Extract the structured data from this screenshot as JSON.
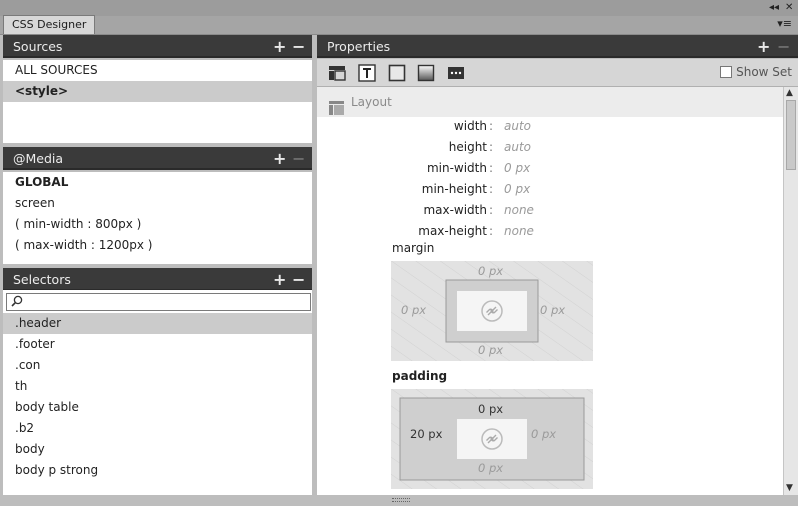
{
  "window": {
    "tab_label": "CSS Designer",
    "collapse_icon": "double-left-arrow-icon",
    "close_icon": "close-icon",
    "menu_icon": "panel-menu-icon"
  },
  "sources": {
    "title": "Sources",
    "items": [
      {
        "label": "ALL SOURCES",
        "selected": false
      },
      {
        "label": "<style>",
        "selected": true
      }
    ]
  },
  "media": {
    "title": "@Media",
    "items": [
      {
        "label": "GLOBAL"
      },
      {
        "label": "screen"
      },
      {
        "label": "( min-width : 800px )"
      },
      {
        "label": "( max-width : 1200px )"
      }
    ]
  },
  "selectors": {
    "title": "Selectors",
    "search_placeholder": "",
    "items": [
      {
        "label": ".header",
        "selected": true
      },
      {
        "label": ".footer"
      },
      {
        "label": ".con"
      },
      {
        "label": "th"
      },
      {
        "label": "body table"
      },
      {
        "label": ".b2"
      },
      {
        "label": "body"
      },
      {
        "label": "body p strong"
      }
    ]
  },
  "properties": {
    "title": "Properties",
    "show_set_label": "Show Set",
    "show_set_checked": false,
    "toolbar_icons": [
      "layout-icon",
      "text-icon",
      "border-icon",
      "background-icon",
      "more-icon"
    ],
    "section_title": "Layout",
    "layout_props": [
      {
        "name": "width",
        "value": "auto"
      },
      {
        "name": "height",
        "value": "auto"
      },
      {
        "name": "min-width",
        "value": "0 px"
      },
      {
        "name": "min-height",
        "value": "0 px"
      },
      {
        "name": "max-width",
        "value": "none"
      },
      {
        "name": "max-height",
        "value": "none"
      }
    ],
    "colon": ":",
    "margin": {
      "label": "margin",
      "top": "0 px",
      "right": "0 px",
      "bottom": "0 px",
      "left": "0 px"
    },
    "padding": {
      "label": "padding",
      "top": "0 px",
      "right": "0 px",
      "bottom": "0 px",
      "left": "20 px"
    }
  },
  "colors": {
    "panel_header": "#3a3a3a",
    "selected_row": "#cbcbcb",
    "chrome": "#bdbdbd"
  }
}
